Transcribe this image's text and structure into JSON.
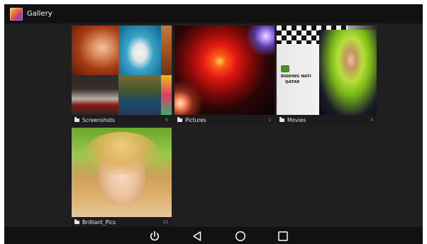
{
  "app": {
    "title": "Gallery",
    "icon": "gallery-icon"
  },
  "albums": [
    {
      "name": "Screenshots",
      "count": "6"
    },
    {
      "name": "Pictures",
      "count": "1"
    },
    {
      "name": "Movies",
      "count": "4"
    },
    {
      "name": "Brilliant_Pics",
      "count": "33"
    }
  ],
  "movies_banner": {
    "line1": "BIDDING NATI",
    "line2": "QATAR"
  },
  "navbar": {
    "buttons": [
      "power-icon",
      "back-icon",
      "home-icon",
      "recents-icon"
    ]
  },
  "colors": {
    "background": "#1f1f1f",
    "bars": "#111111",
    "label_bar": "#1e1e1e"
  }
}
